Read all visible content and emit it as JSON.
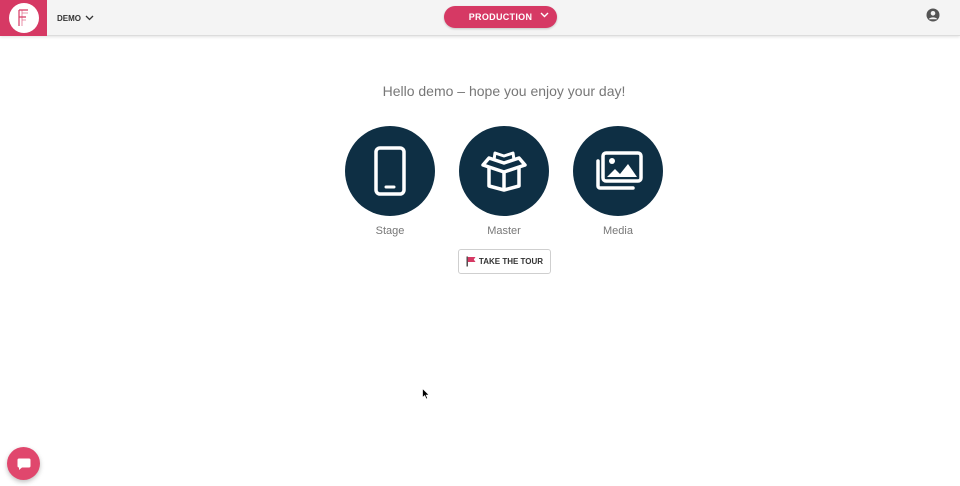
{
  "header": {
    "org_selector_label": "DEMO",
    "environment_button_label": "PRODUCTION",
    "brand_color": "#d63964"
  },
  "main": {
    "greeting": "Hello demo – hope you enjoy your day!",
    "tiles": [
      {
        "label": "Stage",
        "icon": "mobile-phone-icon"
      },
      {
        "label": "Master",
        "icon": "open-box-icon"
      },
      {
        "label": "Media",
        "icon": "images-icon"
      }
    ],
    "tour_button_label": "TAKE THE TOUR",
    "tile_color": "#0e2f44"
  },
  "chat": {
    "icon": "chat-bubble-icon"
  }
}
